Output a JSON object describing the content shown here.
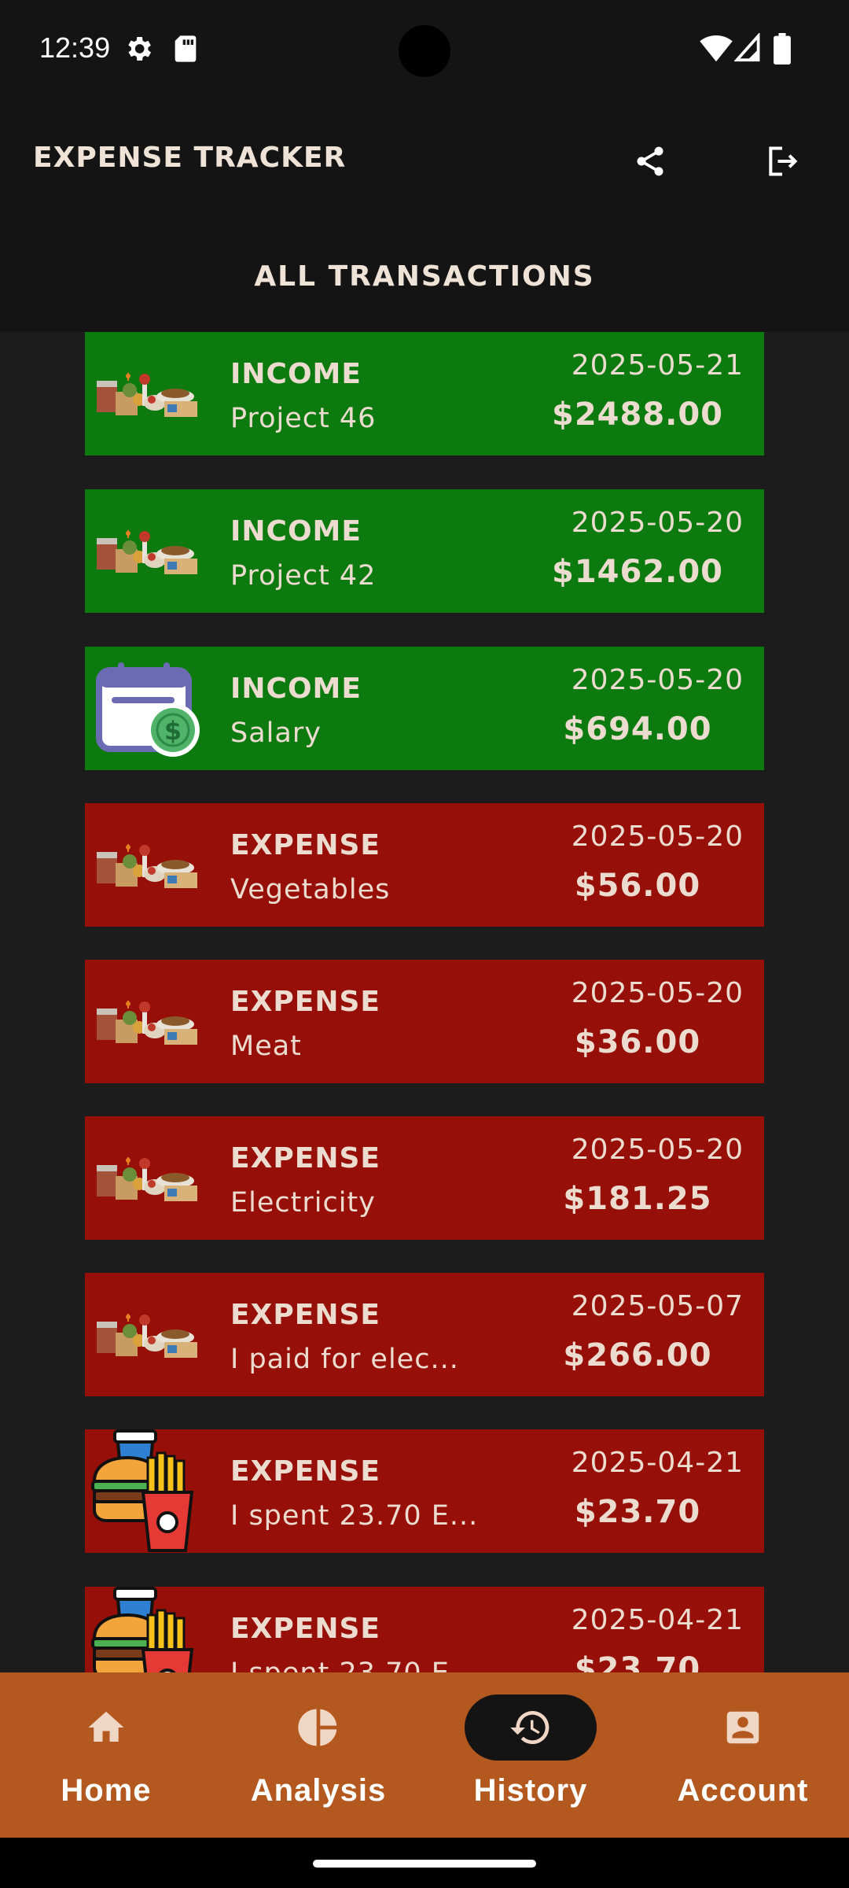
{
  "status_bar": {
    "time": "12:39",
    "icons": [
      "settings-gear-icon",
      "sd-card-icon",
      "wifi-icon",
      "cellular-signal-icon",
      "battery-icon"
    ]
  },
  "app_bar": {
    "title": "EXPENSE TRACKER",
    "actions": [
      "share-icon",
      "logout-icon"
    ]
  },
  "section": {
    "title": "ALL TRANSACTIONS"
  },
  "transactions": [
    {
      "type": "INCOME",
      "description": "Project 46",
      "date": "2025-05-21",
      "amount": "$2488.00",
      "icon": "food-assortment-icon"
    },
    {
      "type": "INCOME",
      "description": "Project 42",
      "date": "2025-05-20",
      "amount": "$1462.00",
      "icon": "food-assortment-icon"
    },
    {
      "type": "INCOME",
      "description": "Salary",
      "date": "2025-05-20",
      "amount": "$694.00",
      "icon": "calendar-payment-icon"
    },
    {
      "type": "EXPENSE",
      "description": "Vegetables",
      "date": "2025-05-20",
      "amount": "$56.00",
      "icon": "food-assortment-icon"
    },
    {
      "type": "EXPENSE",
      "description": "Meat",
      "date": "2025-05-20",
      "amount": "$36.00",
      "icon": "food-assortment-icon"
    },
    {
      "type": "EXPENSE",
      "description": "Electricity",
      "date": "2025-05-20",
      "amount": "$181.25",
      "icon": "food-assortment-icon"
    },
    {
      "type": "EXPENSE",
      "description": "I paid for elec...",
      "date": "2025-05-07",
      "amount": "$266.00",
      "icon": "food-assortment-icon"
    },
    {
      "type": "EXPENSE",
      "description": "I spent 23.70 E...",
      "date": "2025-04-21",
      "amount": "$23.70",
      "icon": "fast-food-icon"
    },
    {
      "type": "EXPENSE",
      "description": "I spent 23.70 E...",
      "date": "2025-04-21",
      "amount": "$23.70",
      "icon": "fast-food-icon"
    }
  ],
  "colors": {
    "income": "#0d7a10",
    "expense": "#960f08",
    "nav_background": "#b3581f",
    "app_background": "#1c1c1c"
  },
  "bottom_nav": {
    "items": [
      {
        "label": "Home",
        "icon": "home-icon",
        "active": false
      },
      {
        "label": "Analysis",
        "icon": "pie-chart-icon",
        "active": false
      },
      {
        "label": "History",
        "icon": "history-icon",
        "active": true
      },
      {
        "label": "Account",
        "icon": "account-icon",
        "active": false
      }
    ]
  }
}
